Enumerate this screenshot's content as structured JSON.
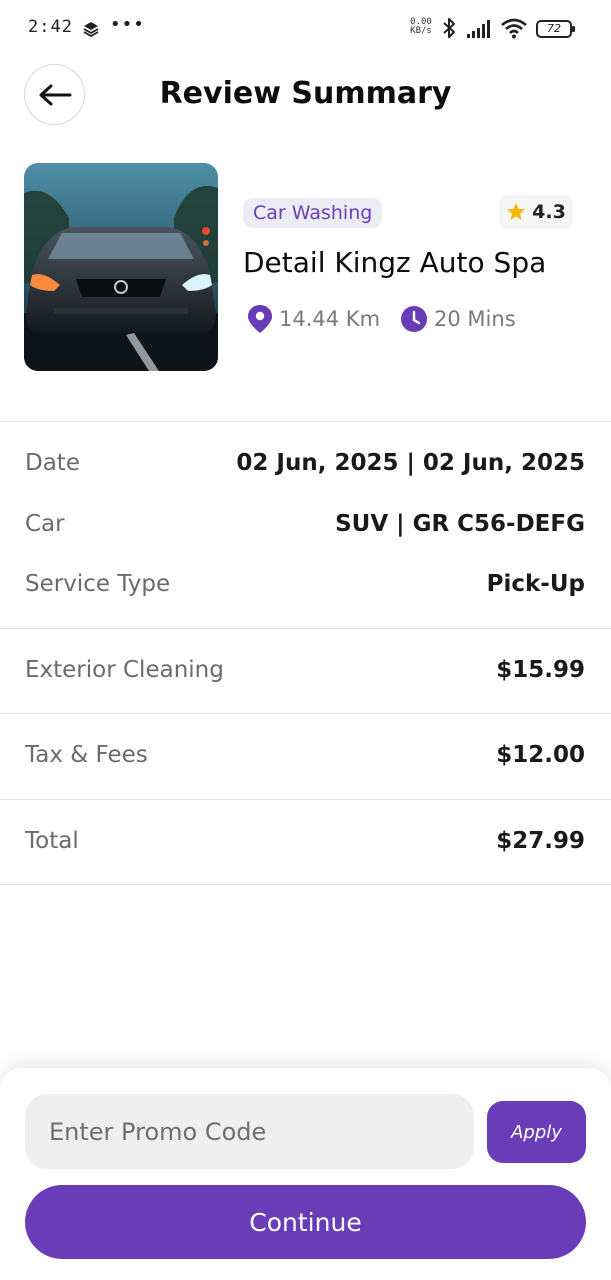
{
  "status_bar": {
    "time": "2:42",
    "dots": "•••",
    "speed_value": "0.00",
    "speed_unit": "KB/s",
    "battery": "72"
  },
  "header": {
    "title": "Review Summary"
  },
  "shop": {
    "category": "Car Washing",
    "rating": "4.3",
    "name": "Detail Kingz Auto Spa",
    "distance": "14.44 Km",
    "duration": "20 Mins"
  },
  "details": {
    "date_label": "Date",
    "date_value": "02 Jun, 2025 | 02 Jun, 2025",
    "car_label": "Car",
    "car_value": "SUV | GR C56-DEFG",
    "service_label": "Service Type",
    "service_value": "Pick-Up",
    "item_label": "Exterior Cleaning",
    "item_value": "$15.99",
    "tax_label": "Tax & Fees",
    "tax_value": "$12.00",
    "total_label": "Total",
    "total_value": "$27.99"
  },
  "bottom": {
    "promo_placeholder": "Enter Promo Code",
    "apply_label": "Apply",
    "continue_label": "Continue"
  },
  "colors": {
    "accent": "#6a3db8",
    "rating_star": "#f5b700"
  },
  "icons": [
    "back-arrow-icon",
    "star-icon",
    "location-pin-icon",
    "clock-icon",
    "layers-icon",
    "bluetooth-icon",
    "signal-icon",
    "wifi-icon",
    "battery-icon"
  ]
}
